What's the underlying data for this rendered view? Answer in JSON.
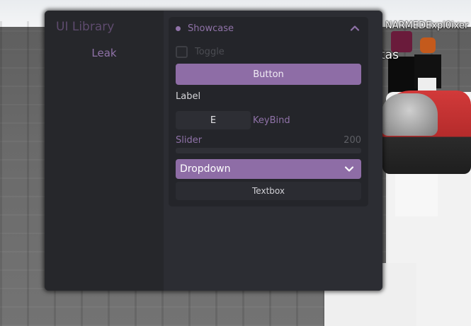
{
  "window": {
    "title": "UI Library",
    "tabs": [
      {
        "label": "Leak"
      }
    ]
  },
  "section": {
    "title": "Showcase",
    "collapse_icon": "chevron-up-icon"
  },
  "controls": {
    "toggle_label": "Toggle",
    "toggle_checked": false,
    "button_label": "Button",
    "label_text": "Label",
    "keybind_key": "E",
    "keybind_label": "KeyBind",
    "slider_label": "Slider",
    "slider_value": "200",
    "dropdown_label": "Dropdown",
    "dropdown_icon": "chevron-down-icon",
    "textbox_placeholder": "Textbox"
  },
  "scene": {
    "player_name": "NARMEDExpl0ixer",
    "player_name_partial": "tas"
  },
  "colors": {
    "accent": "#8e6da6",
    "accent_text": "#8f72a8",
    "window_bg": "#2a2b31",
    "sidebar_bg": "#26272b",
    "section_bg": "#24252a"
  }
}
